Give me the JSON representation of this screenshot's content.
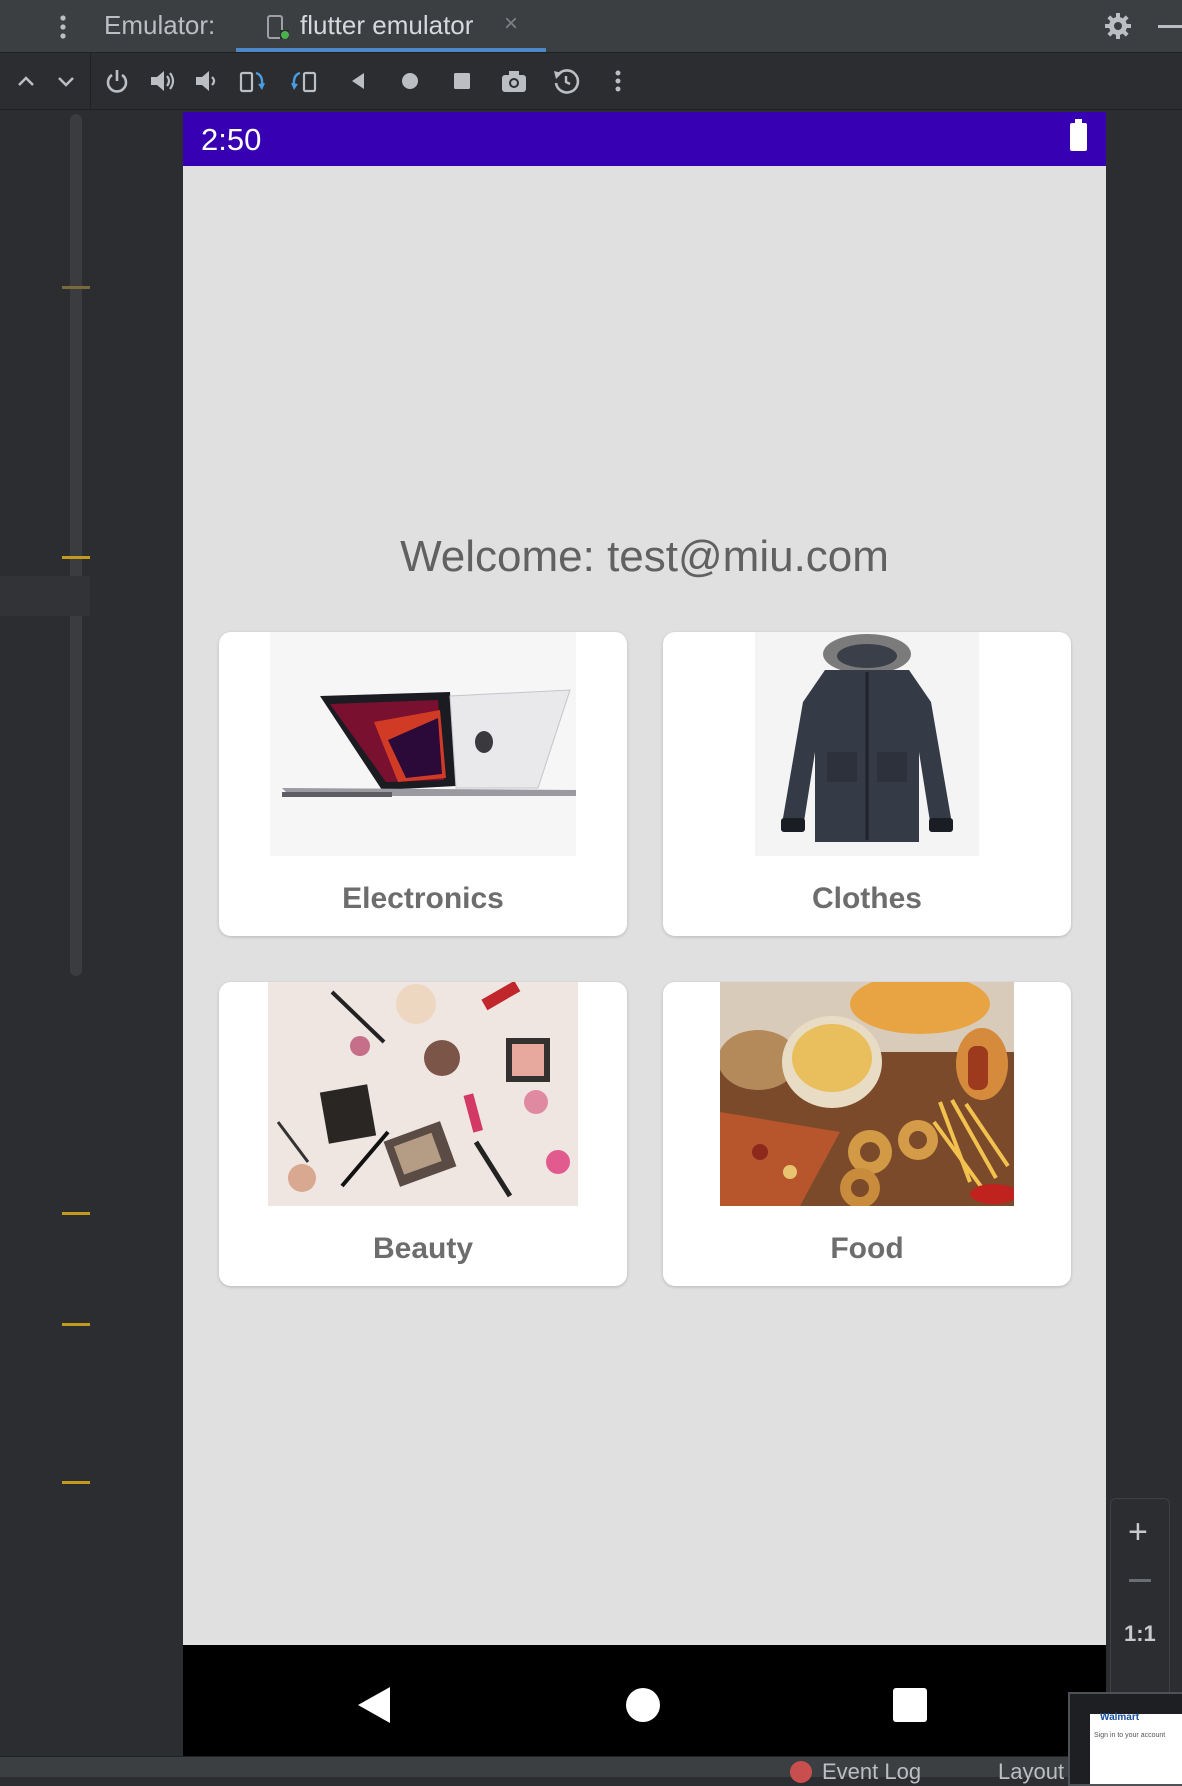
{
  "ide": {
    "panel_title": "Emulator:",
    "tab_label": "flutter emulator",
    "tab_close": "×",
    "zoom_plus": "+",
    "zoom_one_to_one": "1:1",
    "bottom_event_log": "Event Log",
    "bottom_layout": "Layout"
  },
  "toolbar_icons": [
    "power-icon",
    "volume-up-icon",
    "volume-down-icon",
    "rotate-left-icon",
    "rotate-right-icon",
    "back-icon",
    "home-icon",
    "overview-icon",
    "screenshot-icon",
    "snapshot-icon",
    "more-icon"
  ],
  "phone": {
    "time": "2:50",
    "welcome": "Welcome: test@miu.com",
    "categories": [
      {
        "label": "Electronics",
        "image": "laptop"
      },
      {
        "label": "Clothes",
        "image": "jacket"
      },
      {
        "label": "Beauty",
        "image": "cosmetics"
      },
      {
        "label": "Food",
        "image": "snacks"
      }
    ]
  },
  "thumbnail": {
    "brand": "Walmart",
    "subtitle": "Sign in to your account"
  },
  "colors": {
    "status_bar": "#3700b3",
    "phone_bg": "#e0e0e0",
    "ide_dark": "#2b2d30",
    "accent_underline": "#4a88c7"
  }
}
